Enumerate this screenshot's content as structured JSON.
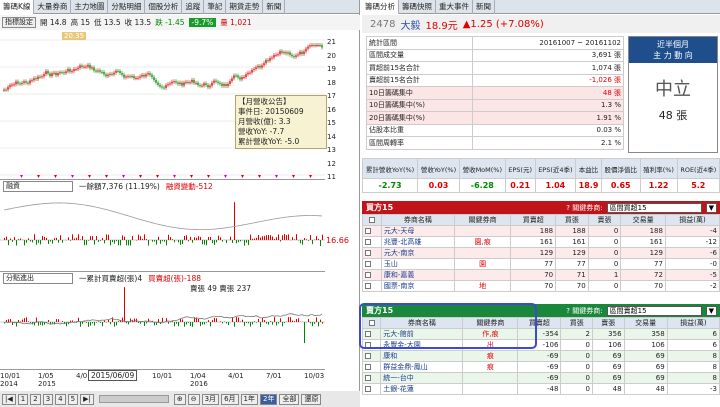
{
  "left_tabs": [
    "籌碼K線",
    "大量券商",
    "主力地圖",
    "分點明細",
    "個股分析",
    "追蹤",
    "筆記",
    "期貨走勢",
    "新聞"
  ],
  "settings_button": "指標設定",
  "quote": {
    "open": "開 14.8",
    "high": "高 15",
    "low": "低 13.5",
    "close": "收 13.5",
    "change": "跌 -1.45",
    "change_pct": "-9.7%",
    "volume": "量 1,021"
  },
  "price_axis": [
    "21",
    "20",
    "19",
    "18",
    "17",
    "16",
    "15",
    "14",
    "13",
    "12",
    "11"
  ],
  "price_tag": "20.35",
  "tooltip": {
    "title": "【月營收公告】",
    "lines": [
      "事件日: 20150609",
      "月營收(億): 3.3",
      "營收YoY: -7.7",
      "累計營收YoY: -5.0"
    ]
  },
  "margin_pane": {
    "select": "融資",
    "legend": "一餘額7,376 (11.19%)",
    "legend2": "融資變動-512",
    "side_value": "16.66"
  },
  "branch_pane": {
    "select": "分點進出",
    "legend": "一累計買賣超(張)4",
    "legend2": "買賣超(張)-188",
    "legend3": "賣張 49 賣張 237"
  },
  "x_ticks": [
    "10/01\n2014",
    "1/05\n2015",
    "4/0",
    "7/01",
    "10/01",
    "1/04\n2016",
    "4/01",
    "7/01",
    "10/03"
  ],
  "cursor_date": "2015/06/09",
  "bottom_pages": [
    "1",
    "2",
    "3",
    "4",
    "5"
  ],
  "bottom_ranges": [
    "3月",
    "6月",
    "1年",
    "2年",
    "全部",
    "還原"
  ],
  "right_tabs": [
    "籌碼分析",
    "籌碼快照",
    "重大事件",
    "新聞"
  ],
  "stock": {
    "code": "2478",
    "name": "大毅",
    "price": "18.9元",
    "change": "▲1.25 (+7.08%)"
  },
  "stats": [
    {
      "label": "統計區間",
      "value": "20161007 ~ 20161102"
    },
    {
      "label": "區間成交量",
      "value": "3,691 張"
    },
    {
      "label": "買超前15名合計",
      "value": "1,074 張"
    },
    {
      "label": "賣超前15名合計",
      "value": "-1,026 張"
    },
    {
      "label": "10日籌碼集中",
      "value": "48 張"
    },
    {
      "label": "10日籌碼集中(%)",
      "value": "1.3 %"
    },
    {
      "label": "20日籌碼集中(%)",
      "value": "1.91 %"
    },
    {
      "label": "佔股本比重",
      "value": "0.03 %"
    },
    {
      "label": "區間周轉率",
      "value": "2.1 %"
    }
  ],
  "summary": {
    "line1": "近半個月",
    "line2": "主 力 動 向",
    "status": "中立",
    "amount": "48 張"
  },
  "metrics": {
    "headers": [
      "累計營收YoY(%)",
      "營收YoY(%)",
      "營收MoM(%)",
      "EPS(元)",
      "EPS(近4季)",
      "本益比",
      "股價淨值比",
      "殖利率(%)",
      "ROE(近4季)"
    ],
    "values": [
      "-2.73",
      "0.03",
      "-6.28",
      "0.21",
      "1.04",
      "18.9",
      "0.65",
      "1.22",
      "5.2"
    ]
  },
  "buy": {
    "title": "買方15",
    "hint": "? 關鍵券商:",
    "select": "區間買超15",
    "headers": [
      "",
      "券商名稱",
      "關鍵券商",
      "買賣超",
      "買張",
      "賣張",
      "交易量",
      "損益(萬)"
    ],
    "rows": [
      [
        "元大-天母",
        "",
        "188",
        "188",
        "0",
        "188",
        "-4"
      ],
      [
        "兆豐-北高雄",
        "園,痕",
        "161",
        "161",
        "0",
        "161",
        "-12"
      ],
      [
        "元大-南京",
        "",
        "129",
        "129",
        "0",
        "129",
        "-6"
      ],
      [
        "玉山",
        "園",
        "77",
        "77",
        "0",
        "77",
        "-0"
      ],
      [
        "康和-嘉義",
        "",
        "70",
        "71",
        "1",
        "72",
        "-5"
      ],
      [
        "國票-南京",
        "地",
        "70",
        "70",
        "0",
        "70",
        "-2"
      ]
    ]
  },
  "sell": {
    "title": "賣方15",
    "hint": "? 關鍵券商:",
    "select": "區間賣超15",
    "headers": [
      "",
      "券商名稱",
      "關鍵券商",
      "買賣超",
      "買張",
      "賣張",
      "交易量",
      "損益(萬)"
    ],
    "rows": [
      [
        "元大-館前",
        "作,痕",
        "-354",
        "2",
        "356",
        "358",
        "6"
      ],
      [
        "永豐金-大園",
        "出",
        "-106",
        "0",
        "106",
        "106",
        "6"
      ],
      [
        "康和",
        "痕",
        "-69",
        "0",
        "69",
        "69",
        "8"
      ],
      [
        "群益金鼎-鳳山",
        "痕",
        "-69",
        "0",
        "69",
        "69",
        "8"
      ],
      [
        "統一-台中",
        "",
        "-69",
        "0",
        "69",
        "69",
        "8"
      ],
      [
        "土銀-花蓮",
        "",
        "-48",
        "0",
        "48",
        "48",
        "-3"
      ]
    ]
  }
}
